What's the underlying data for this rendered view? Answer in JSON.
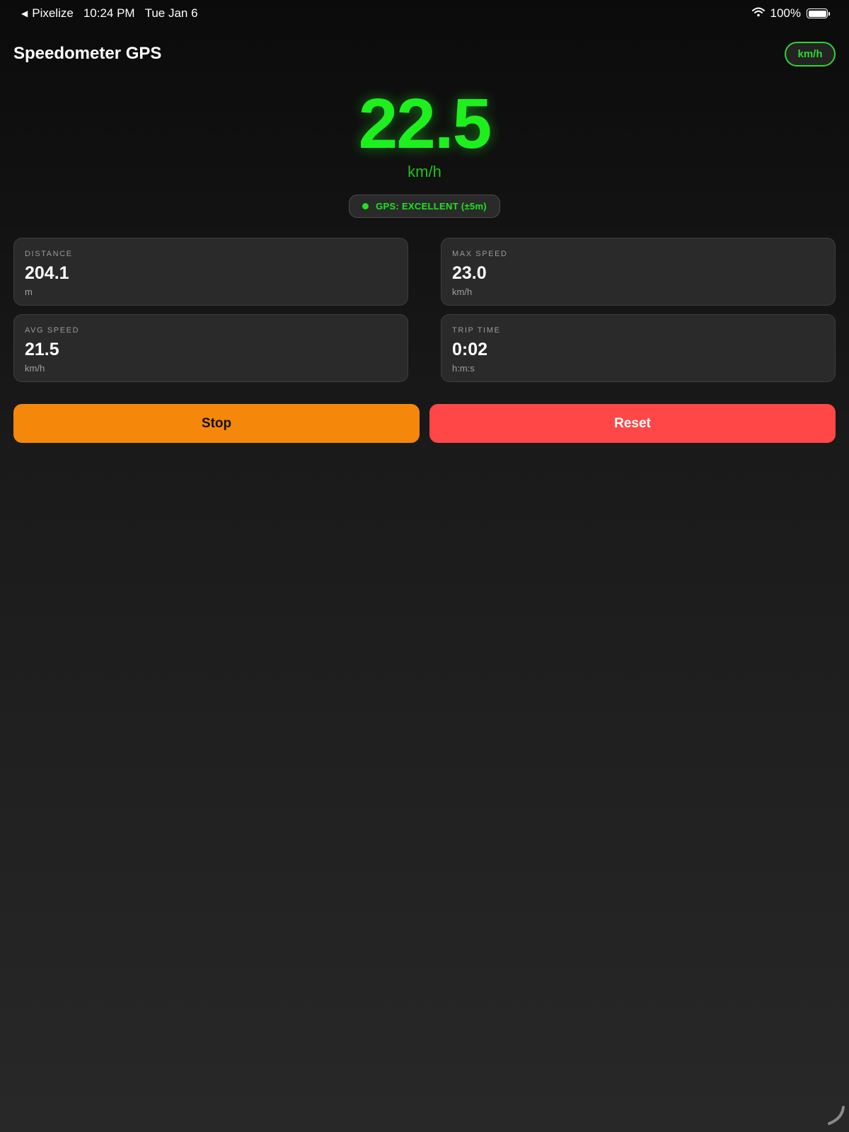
{
  "status_bar": {
    "back_app": "Pixelize",
    "time": "10:24 PM",
    "date": "Tue Jan 6",
    "battery": "100%"
  },
  "header": {
    "title": "Speedometer GPS",
    "unit_toggle": "km/h"
  },
  "speed": {
    "value": "22.5",
    "unit": "km/h"
  },
  "gps": {
    "status": "GPS: EXCELLENT (±5m)"
  },
  "stats": {
    "distance": {
      "label": "DISTANCE",
      "value": "204.1",
      "unit": "m"
    },
    "max_speed": {
      "label": "MAX SPEED",
      "value": "23.0",
      "unit": "km/h"
    },
    "avg_speed": {
      "label": "AVG SPEED",
      "value": "21.5",
      "unit": "km/h"
    },
    "trip_time": {
      "label": "TRIP TIME",
      "value": "0:02",
      "unit": "h:m:s"
    }
  },
  "buttons": {
    "stop": "Stop",
    "reset": "Reset"
  },
  "colors": {
    "accent_green": "#1ef01e",
    "stop_orange": "#f5870a",
    "reset_red": "#ff4747"
  },
  "icons": [
    "back-arrow-icon",
    "wifi-icon",
    "battery-icon",
    "resize-handle-icon"
  ]
}
